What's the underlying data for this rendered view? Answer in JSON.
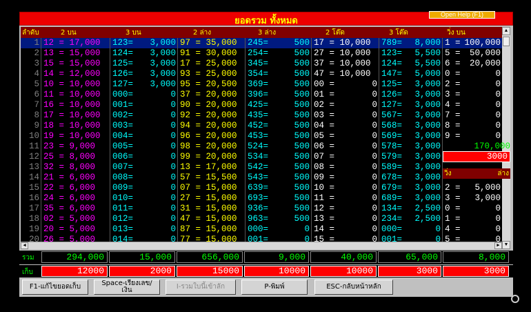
{
  "window": {
    "title": "ยอดรวม ทั้งหมด",
    "help": "Open Help (F1)"
  },
  "header": [
    "ลำดับ",
    "2 บน",
    "3 บน",
    "2 ล่าง",
    "3 ล่าง",
    "2 โต๊ด",
    "3 โต๊ด",
    "วิ่ง บน"
  ],
  "rows": [
    [
      "1",
      "12 = 17,000",
      "123=",
      "3,000",
      "97 = 35,000",
      "245=",
      "500",
      "17 = 10,000",
      "789=",
      "8,000",
      "1 =",
      "100,000"
    ],
    [
      "2",
      "13 = 15,000",
      "124=",
      "3,000",
      "91 = 30,000",
      "254=",
      "500",
      "27 = 10,000",
      "123=",
      "5,500",
      "5 =",
      "50,000"
    ],
    [
      "3",
      "15 = 15,000",
      "125=",
      "3,000",
      "17 = 25,000",
      "345=",
      "500",
      "37 = 10,000",
      "124=",
      "5,500",
      "6 =",
      "20,000"
    ],
    [
      "4",
      "14 = 12,000",
      "126=",
      "3,000",
      "93 = 25,000",
      "354=",
      "500",
      "47 = 10,000",
      "147=",
      "5,000",
      "0 =",
      "0"
    ],
    [
      "5",
      "10 = 10,000",
      "127=",
      "3,000",
      "95 = 20,500",
      "369=",
      "500",
      "00 =",
      "0",
      "125=",
      "3,000",
      "2 =",
      "0"
    ],
    [
      "6",
      "11 = 10,000",
      "000=",
      "0",
      "37 = 20,000",
      "396=",
      "500",
      "01 =",
      "0",
      "126=",
      "3,000",
      "3 =",
      "0"
    ],
    [
      "7",
      "16 = 10,000",
      "001=",
      "0",
      "90 = 20,000",
      "425=",
      "500",
      "02 =",
      "0",
      "127=",
      "3,000",
      "4 =",
      "0"
    ],
    [
      "8",
      "17 = 10,000",
      "002=",
      "0",
      "92 = 20,000",
      "435=",
      "500",
      "03 =",
      "0",
      "567=",
      "3,000",
      "7 =",
      "0"
    ],
    [
      "9",
      "18 = 10,000",
      "003=",
      "0",
      "94 = 20,000",
      "452=",
      "500",
      "04 =",
      "0",
      "568=",
      "3,000",
      "8 =",
      "0"
    ],
    [
      "10",
      "19 = 10,000",
      "004=",
      "0",
      "96 = 20,000",
      "453=",
      "500",
      "05 =",
      "0",
      "569=",
      "3,000",
      "9 =",
      "0"
    ],
    [
      "11",
      "23 = 9,000",
      "005=",
      "0",
      "98 = 20,000",
      "524=",
      "500",
      "06 =",
      "0",
      "578=",
      "3,000",
      "",
      ""
    ],
    [
      "12",
      "25 = 8,000",
      "006=",
      "0",
      "99 = 20,000",
      "534=",
      "500",
      "07 =",
      "0",
      "579=",
      "3,000",
      "",
      ""
    ],
    [
      "13",
      "32 = 8,000",
      "007=",
      "0",
      "13 = 17,000",
      "542=",
      "500",
      "08 =",
      "0",
      "589=",
      "3,000",
      "",
      ""
    ],
    [
      "14",
      "21 = 6,000",
      "008=",
      "0",
      "57 = 15,500",
      "543=",
      "500",
      "09 =",
      "0",
      "678=",
      "3,000",
      "",
      ""
    ],
    [
      "15",
      "22 = 6,000",
      "009=",
      "0",
      "07 = 15,000",
      "639=",
      "500",
      "10 =",
      "0",
      "679=",
      "3,000",
      "2 =",
      "5,000"
    ],
    [
      "16",
      "24 = 6,000",
      "010=",
      "0",
      "27 = 15,000",
      "693=",
      "500",
      "11 =",
      "0",
      "689=",
      "3,000",
      "3 =",
      "3,000"
    ],
    [
      "17",
      "35 = 6,000",
      "011=",
      "0",
      "31 = 15,000",
      "936=",
      "500",
      "12 =",
      "0",
      "134=",
      "2,500",
      "0 =",
      "0"
    ],
    [
      "18",
      "02 = 5,000",
      "012=",
      "0",
      "47 = 15,000",
      "963=",
      "500",
      "13 =",
      "0",
      "234=",
      "2,500",
      "1 =",
      "0"
    ],
    [
      "19",
      "20 = 5,000",
      "013=",
      "0",
      "87 = 15,000",
      "000=",
      "0",
      "14 =",
      "0",
      "000=",
      "0",
      "4 =",
      "0"
    ],
    [
      "20",
      "26 = 5,000",
      "014=",
      "0",
      "77 = 15,000",
      "001=",
      "0",
      "15 =",
      "0",
      "001=",
      "0",
      "5 =",
      "0"
    ]
  ],
  "side": {
    "run_top_total": "170,000",
    "run_top_keep": "3000",
    "run_bottom_label_left": "วิ่ง",
    "run_bottom_label_right": "ล่าง"
  },
  "totals": {
    "label": "รวม",
    "values": [
      "294,000",
      "15,000",
      "656,000",
      "9,000",
      "40,000",
      "65,000",
      "8,000"
    ]
  },
  "keep": {
    "label": "เก็บ",
    "values": [
      "12000",
      "2000",
      "15000",
      "10000",
      "10000",
      "3000",
      "3000"
    ]
  },
  "buttons": [
    "F1-แก้ไขยอดเก็บ",
    "Space-เรียงเลข/เงิน",
    "I-รวมใบนี้เข้าลัก",
    "P-พิมพ์",
    "ESC-กลับหน้าหลัก"
  ],
  "colors": {
    "title_bg": "#ee0000",
    "header_bg": "#800000",
    "key_colors": [
      "#ff00ff",
      "#00ffff",
      "#ffff00",
      "#00ffff",
      "#ffffff",
      "#00ffff",
      "#ffffff"
    ]
  }
}
